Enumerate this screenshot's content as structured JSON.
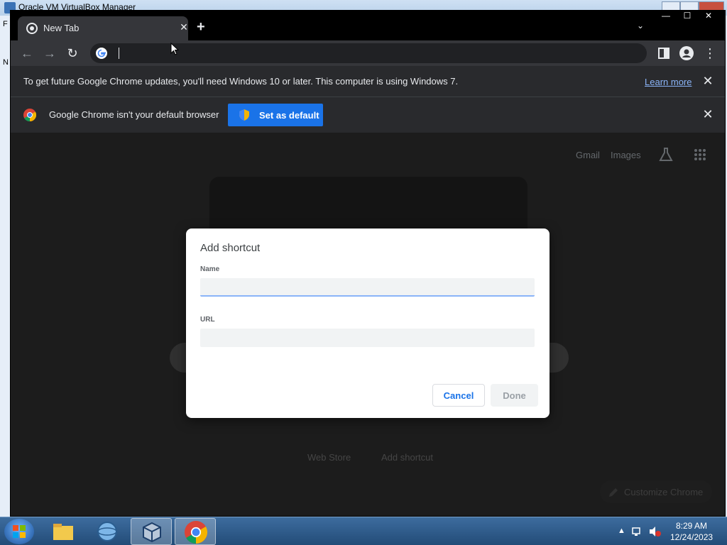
{
  "vbox": {
    "title": "Oracle VM VirtualBox Manager",
    "left_glyphs": [
      "F",
      "N"
    ]
  },
  "tab": {
    "title": "New Tab",
    "close": "✕",
    "new_tab": "+",
    "search_tabs": "⌄"
  },
  "window": {
    "minimize": "—",
    "maximize": "☐",
    "close": "✕"
  },
  "toolbar": {
    "back": "←",
    "forward": "→",
    "reload": "↻",
    "address_value": "",
    "menu": "⋮"
  },
  "infobar_update": {
    "text": "To get future Google Chrome updates, you'll need Windows 10 or later. This computer is using Windows 7.",
    "link": "Learn more",
    "close": "✕"
  },
  "infobar_default": {
    "text": "Google Chrome isn't your default browser",
    "button": "Set as default",
    "close": "✕"
  },
  "ntp": {
    "gmail": "Gmail",
    "images": "Images",
    "tiles": [
      "Web Store",
      "Add shortcut"
    ],
    "customize": "Customize Chrome"
  },
  "dialog": {
    "title": "Add shortcut",
    "name_label": "Name",
    "name_value": "",
    "url_label": "URL",
    "url_value": "",
    "cancel": "Cancel",
    "done": "Done"
  },
  "taskbar": {
    "time": "8:29 AM",
    "date": "12/24/2023",
    "tray_up": "▲"
  },
  "colors": {
    "accent": "#1a73e8",
    "chrome_dark": "#202124",
    "link": "#8ab4f8"
  }
}
